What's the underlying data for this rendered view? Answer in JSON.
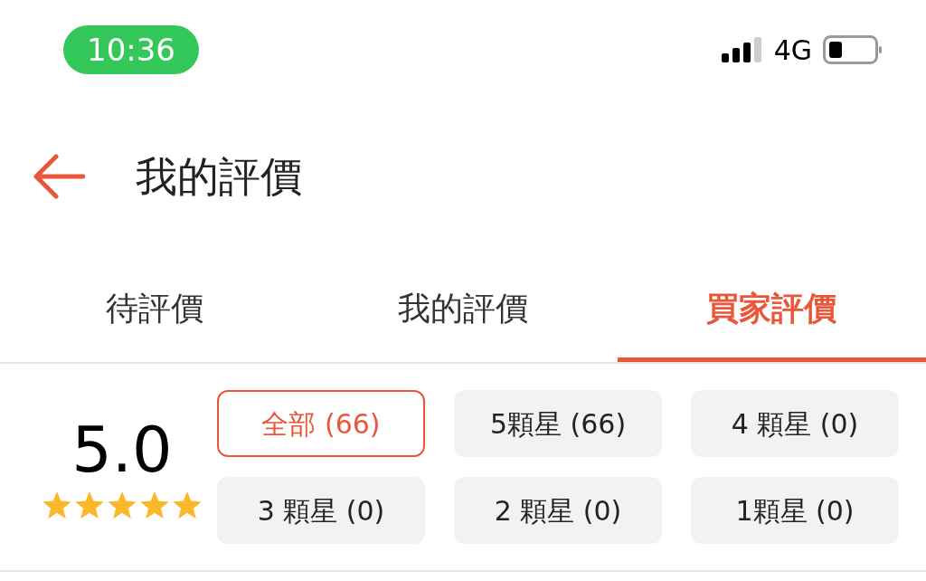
{
  "status_bar": {
    "time": "10:36",
    "network": "4G"
  },
  "header": {
    "title": "我的評價"
  },
  "tabs": [
    {
      "label": "待評價",
      "selected": false
    },
    {
      "label": "我的評價",
      "selected": false
    },
    {
      "label": "買家評價",
      "selected": true
    }
  ],
  "summary": {
    "score": "5.0",
    "stars": 5
  },
  "filters": [
    {
      "label": "全部 (66)",
      "selected": true
    },
    {
      "label": "5顆星 (66)",
      "selected": false
    },
    {
      "label": "4 顆星 (0)",
      "selected": false
    },
    {
      "label": "3 顆星 (0)",
      "selected": false
    },
    {
      "label": "2 顆星 (0)",
      "selected": false
    },
    {
      "label": "1顆星 (0)",
      "selected": false
    }
  ]
}
